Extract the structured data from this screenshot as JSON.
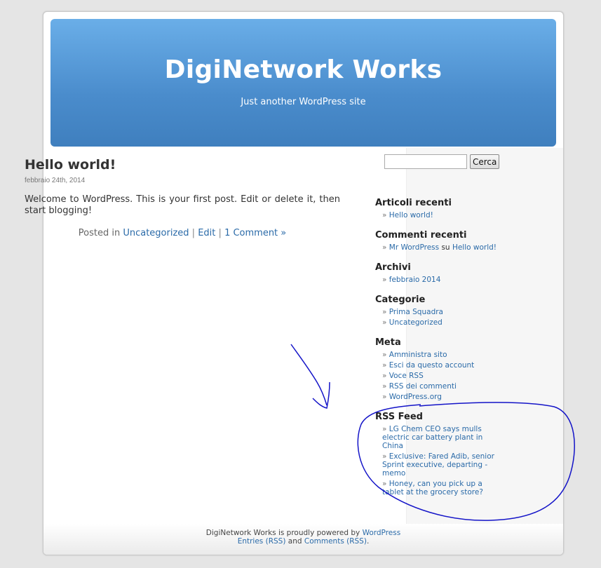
{
  "header": {
    "title": "DigiNetwork Works",
    "tagline": "Just another WordPress site"
  },
  "post": {
    "title": "Hello world!",
    "date": "febbraio 24th, 2014",
    "body": "Welcome to WordPress. This is your first post. Edit or delete it, then start blogging!",
    "meta_prefix": "Posted in",
    "category": "Uncategorized",
    "separator": "|",
    "edit": "Edit",
    "comments": "1 Comment »"
  },
  "search": {
    "value": "",
    "button_label": "Cerca"
  },
  "sidebar": {
    "recent_posts": {
      "title": "Articoli recenti",
      "items": [
        "Hello world!"
      ]
    },
    "recent_comments": {
      "title": "Commenti recenti",
      "author": "Mr WordPress",
      "connector": "su",
      "post": "Hello world!"
    },
    "archives": {
      "title": "Archivi",
      "items": [
        "febbraio 2014"
      ]
    },
    "categories": {
      "title": "Categorie",
      "items": [
        "Prima Squadra",
        "Uncategorized"
      ]
    },
    "meta": {
      "title": "Meta",
      "items": [
        "Amministra sito",
        "Esci da questo account",
        "Voce RSS",
        "RSS dei commenti",
        "WordPress.org"
      ]
    },
    "rss": {
      "title": "RSS Feed",
      "items": [
        "LG Chem CEO says mulls electric car battery plant in China",
        "Exclusive: Fared Adib, senior Sprint executive, departing - memo",
        "Honey, can you pick up a tablet at the grocery store?"
      ]
    }
  },
  "footer": {
    "text_prefix": "DigiNetwork Works is proudly powered by",
    "wordpress_link": "WordPress",
    "entries_link": "Entries (RSS)",
    "and": "and",
    "comments_link": "Comments (RSS)",
    "period": "."
  },
  "colors": {
    "header_gradient_top": "#6aaee8",
    "header_gradient_bottom": "#3f7fbe",
    "link": "#2a6aa8",
    "annotation_ink": "#1414c8"
  }
}
